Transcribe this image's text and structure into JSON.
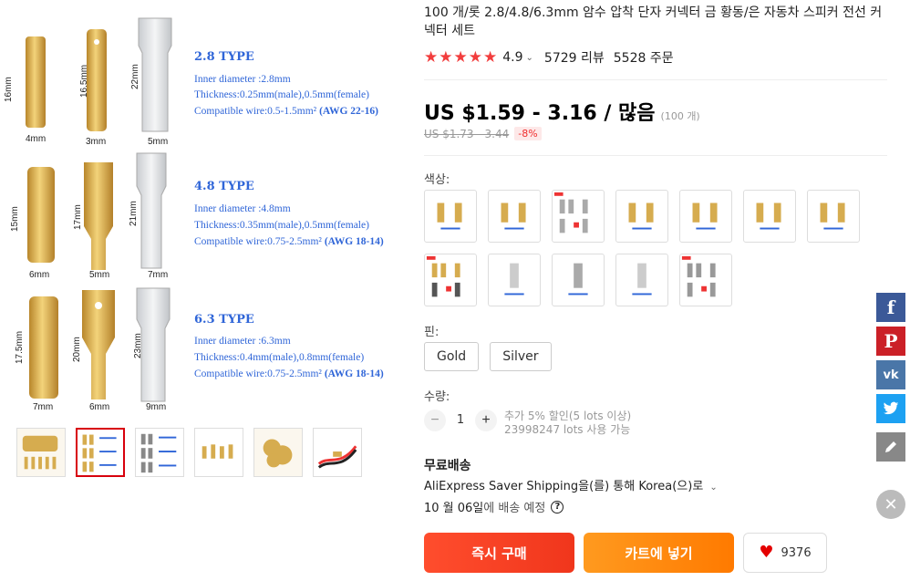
{
  "product": {
    "title": "100 개/롯 2.8/4.8/6.3mm 암수 압착 단자 커넥터 금 황동/은 자동차 스피커 전선 커넥터 세트",
    "rating": "4.9",
    "reviews": "5729 리뷰",
    "orders": "5528 주문"
  },
  "price": {
    "range": "US $1.59 - 3.16 / 많음",
    "unit": "(100 개)",
    "original": "US $1.73 - 3.44",
    "discount": "-8%"
  },
  "main_image": {
    "types": [
      {
        "title": "2.8 TYPE",
        "inner": "Inner diameter :2.8mm",
        "thick": "Thickness:0.25mm(male),0.5mm(female)",
        "wire": "Compatible wire:0.5-1.5mm²",
        "awg": "(AWG 22-16)",
        "dims": [
          "16mm",
          "4mm",
          "16.5mm",
          "3mm",
          "22mm",
          "5mm"
        ]
      },
      {
        "title": "4.8 TYPE",
        "inner": "Inner diameter :4.8mm",
        "thick": "Thickness:0.35mm(male),0.5mm(female)",
        "wire": "Compatible wire:0.75-2.5mm²",
        "awg": "(AWG 18-14)",
        "dims": [
          "15mm",
          "6mm",
          "17mm",
          "5mm",
          "21mm",
          "7mm"
        ]
      },
      {
        "title": "6.3 TYPE",
        "inner": "Inner diameter :6.3mm",
        "thick": "Thickness:0.4mm(male),0.8mm(female)",
        "wire": "Compatible wire:0.75-2.5mm²",
        "awg": "(AWG 18-14)",
        "dims": [
          "17.5mm",
          "7mm",
          "20mm",
          "6mm",
          "23mm",
          "9mm"
        ]
      }
    ]
  },
  "options": {
    "color_label": "색상:",
    "pin_label": "핀:",
    "pins": [
      "Gold",
      "Silver"
    ],
    "qty_label": "수량:",
    "qty_value": "1",
    "qty_note1": "추가 5% 할인(5 lots 이상)",
    "qty_note2": "23998247 lots 사용 가능"
  },
  "shipping": {
    "title": "무료배송",
    "method": "AliExpress Saver Shipping을(를) 통해 Korea(으)로",
    "date_strong": "10 월 06일",
    "date_rest": "에 배송 예정"
  },
  "actions": {
    "buy": "즉시 구매",
    "cart": "카트에 넣기",
    "wishlist_count": "9376"
  },
  "colors": {
    "star": "#f23d3d",
    "buy": "#f0361c",
    "cart": "#ff7a00",
    "facebook": "#3b5998",
    "pinterest": "#cb2027",
    "vk": "#4a76a8",
    "twitter": "#1da1f2"
  },
  "icons": [
    "star-icon",
    "chevron-down-icon",
    "minus-icon",
    "plus-icon",
    "help-icon",
    "heart-icon",
    "facebook-icon",
    "pinterest-icon",
    "vk-icon",
    "twitter-icon",
    "edit-icon",
    "close-icon"
  ]
}
